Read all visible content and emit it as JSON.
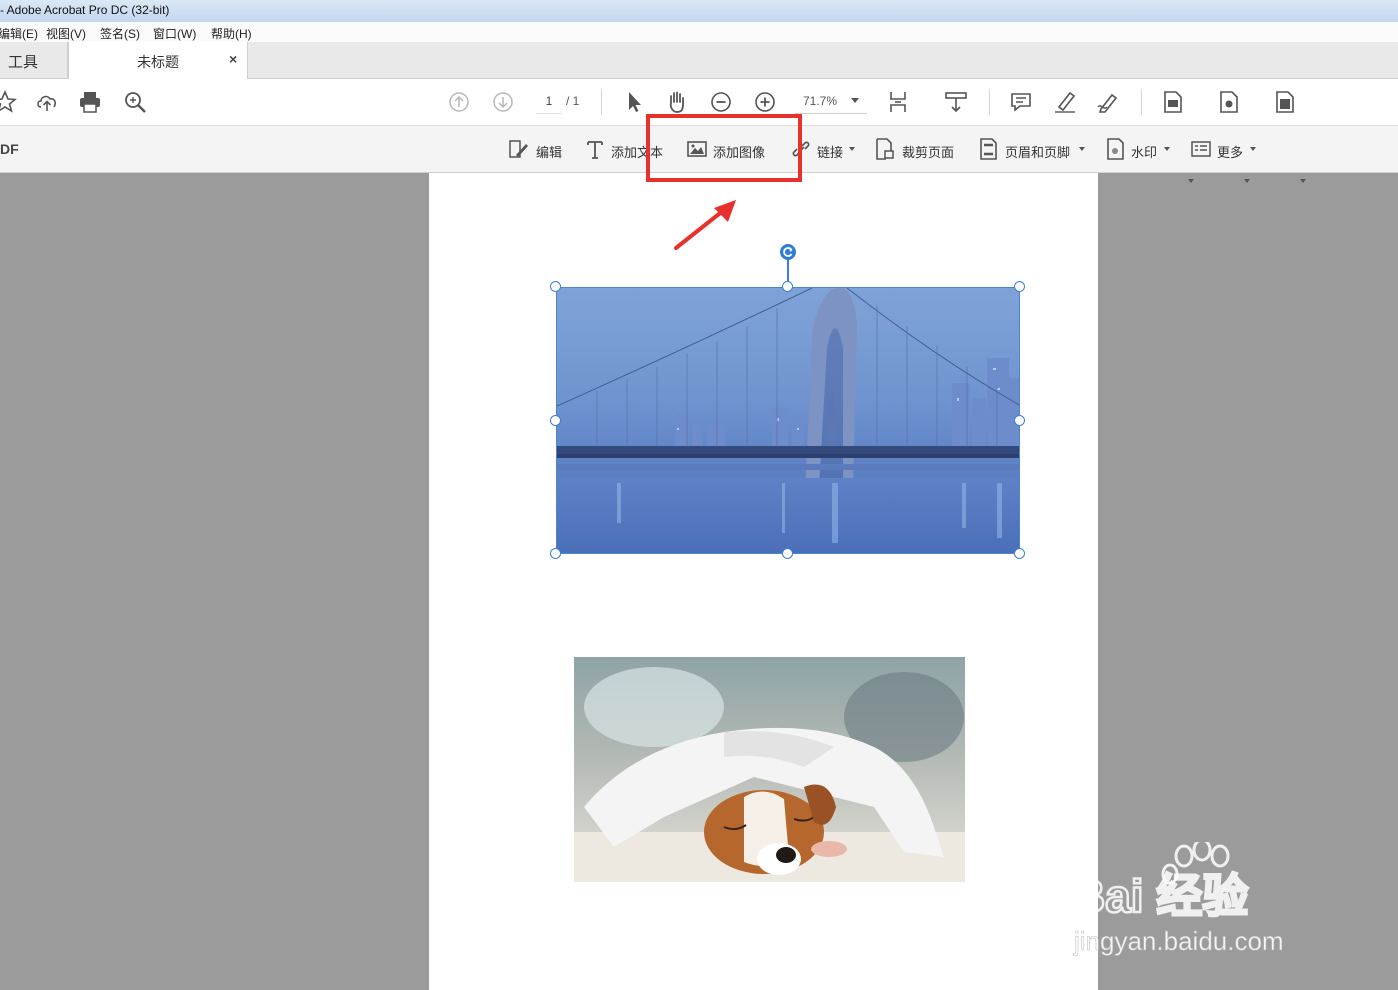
{
  "window": {
    "title": "- Adobe Acrobat Pro DC (32-bit)"
  },
  "menu": [
    "编辑(E)",
    "视图(V)",
    "签名(S)",
    "窗口(W)",
    "帮助(H)"
  ],
  "tabs": {
    "tools": "工具",
    "document": "未标题",
    "close": "×"
  },
  "toolbar": {
    "page_current": "1",
    "page_total": "/ 1",
    "zoom": "71.7%",
    "icons": [
      "star-icon",
      "cloud-upload-icon",
      "print-icon",
      "search-zoom-icon",
      "prev-page-icon",
      "next-page-icon",
      "select-pointer-icon",
      "hand-icon",
      "zoom-out-icon",
      "zoom-in-icon",
      "page-layout-icon",
      "scroll-mode-icon",
      "comment-icon",
      "highlight-pen-icon",
      "sign-icon",
      "file-export-icon",
      "file-create-icon",
      "file-combine-icon"
    ]
  },
  "edit_toolbar": {
    "title": "DF",
    "edit": "编辑",
    "add_text": "添加文本",
    "add_image": "添加图像",
    "link": "链接",
    "crop": "裁剪页面",
    "header_footer": "页眉和页脚",
    "watermark": "水印",
    "more": "更多"
  },
  "document": {
    "images": [
      "bridge-night-photo",
      "sleeping-puppy-photo"
    ]
  },
  "annotation": {
    "color": "#e8302c"
  },
  "watermark": {
    "brand": "Bai 经验",
    "url": "jingyan.baidu.com"
  }
}
